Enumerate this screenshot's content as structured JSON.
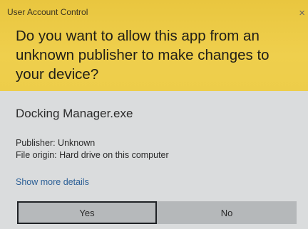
{
  "dialog": {
    "window_title": "User Account Control",
    "close_glyph": "×",
    "question": "Do you want to allow this app from an unknown publisher to make changes to your device?",
    "app_name": "Docking Manager.exe",
    "publisher": "Publisher: Unknown",
    "file_origin": "File origin: Hard drive on this computer",
    "details_link": "Show more details",
    "yes_label": "Yes",
    "no_label": "No"
  },
  "colors": {
    "header_accent": "#eccb46",
    "body_background": "#dadcdd",
    "link": "#2b5f96",
    "button_background": "#b6b9bb",
    "focused_border": "#1f2226"
  },
  "icons": {
    "close": "close-icon"
  }
}
